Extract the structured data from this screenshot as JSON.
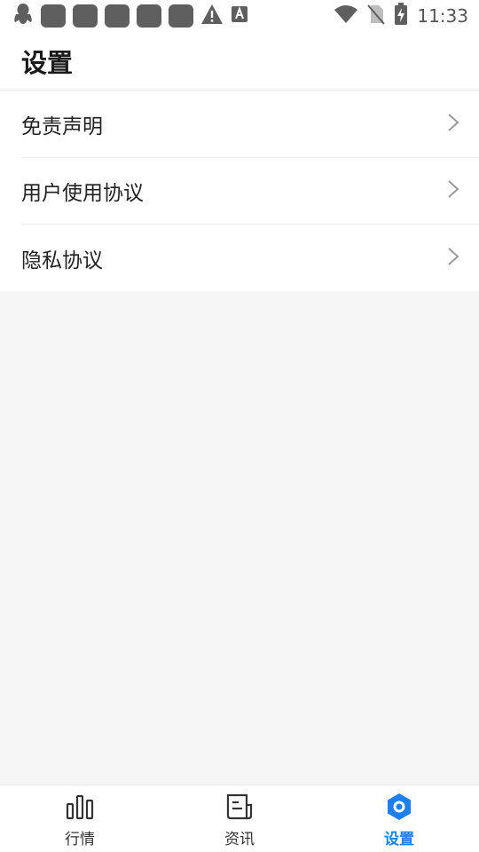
{
  "status_bar": {
    "time": "11:33",
    "notification_icons": [
      "penguin-icon",
      "app-icon",
      "app-icon",
      "app-icon",
      "app-icon",
      "app-icon",
      "warning-icon",
      "font-a-icon"
    ],
    "system_icons": [
      "wifi-icon",
      "no-sim-icon",
      "battery-charging-icon"
    ]
  },
  "header": {
    "title": "设置"
  },
  "settings": {
    "items": [
      {
        "label": "免责声明"
      },
      {
        "label": "用户使用协议"
      },
      {
        "label": "隐私协议"
      }
    ]
  },
  "bottom_nav": {
    "items": [
      {
        "label": "行情",
        "icon": "bar-chart-icon",
        "active": false
      },
      {
        "label": "资讯",
        "icon": "news-icon",
        "active": false
      },
      {
        "label": "设置",
        "icon": "settings-hex-icon",
        "active": true
      }
    ]
  },
  "colors": {
    "accent": "#1e7ff0",
    "background": "#f6f6f6",
    "surface": "#ffffff",
    "text": "#222222"
  }
}
